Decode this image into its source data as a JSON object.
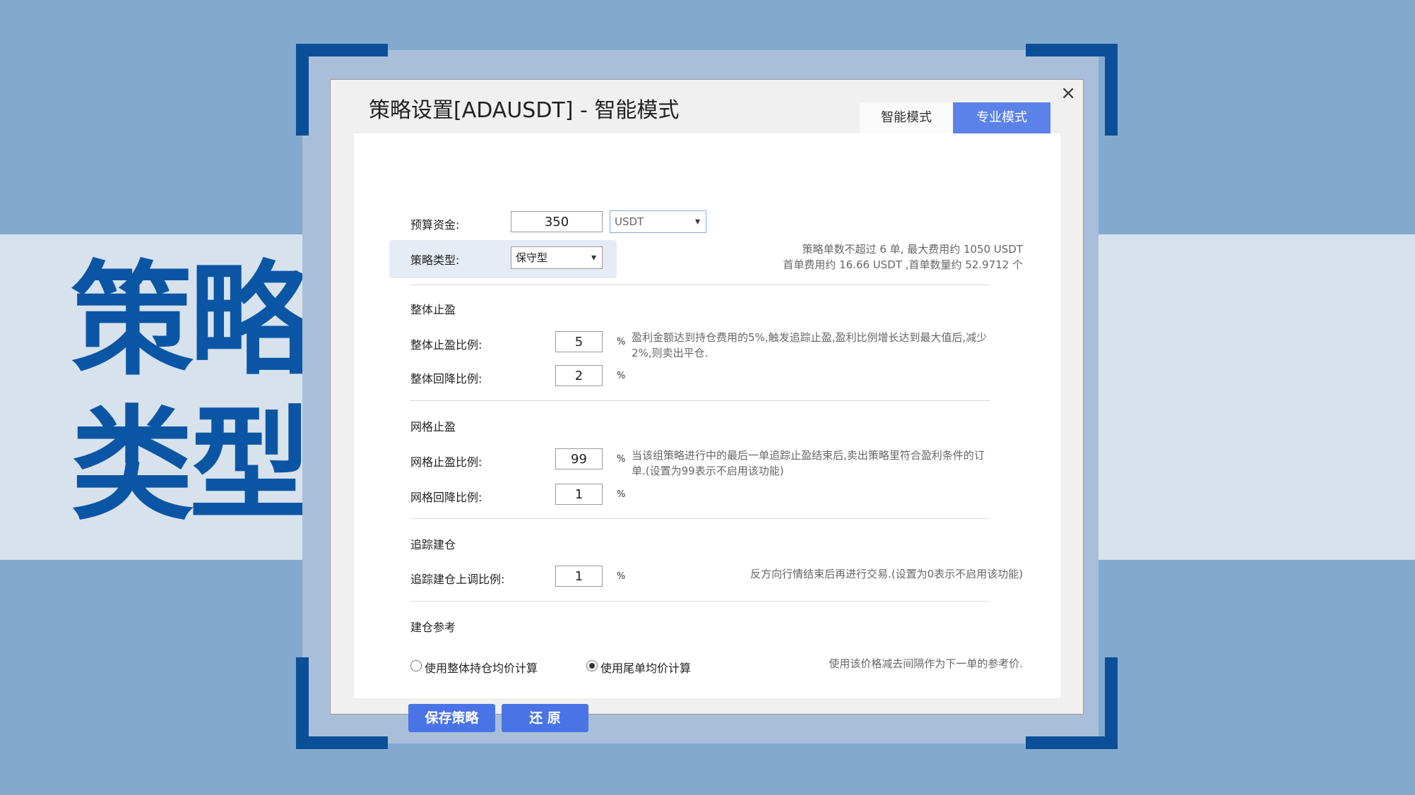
{
  "overlay": {
    "title_line1": "策略",
    "title_line2": "类型"
  },
  "dialog": {
    "title": "策略设置[ADAUSDT] - 智能模式",
    "close_label": "×",
    "tabs": [
      {
        "label": "智能模式",
        "active": false
      },
      {
        "label": "专业模式",
        "active": true
      }
    ]
  },
  "budget": {
    "label": "预算资金:",
    "value": "350",
    "currency": "USDT"
  },
  "strategy_type": {
    "label": "策略类型:",
    "value": "保守型"
  },
  "summary": {
    "line1": "策略单数不超过 6 单, 最大费用约 1050 USDT",
    "line2": "首单费用约 16.66 USDT ,首单数量约 52.9712 个"
  },
  "overall_tp": {
    "section": "整体止盈",
    "ratio_label": "整体止盈比例:",
    "ratio_value": "5",
    "pullback_label": "整体回降比例:",
    "pullback_value": "2",
    "unit": "%",
    "hint_line1": "盈利金额达到持仓费用的5%,触发追踪止盈,盈利比例增长达到最大值后,减少",
    "hint_line2": "2%,则卖出平仓."
  },
  "grid_tp": {
    "section": "网格止盈",
    "ratio_label": "网格止盈比例:",
    "ratio_value": "99",
    "pullback_label": "网格回降比例:",
    "pullback_value": "1",
    "unit": "%",
    "hint_line1": "当该组策略进行中的最后一单追踪止盈结束后,卖出策略里符合盈利条件的订",
    "hint_line2": "单.(设置为99表示不启用该功能)"
  },
  "trail_open": {
    "section": "追踪建仓",
    "ratio_label": "追踪建仓上调比例:",
    "ratio_value": "1",
    "unit": "%",
    "hint": "反方向行情结束后再进行交易.(设置为0表示不启用该功能)"
  },
  "open_ref": {
    "section": "建仓参考",
    "option1": "使用整体持仓均价计算",
    "option2": "使用尾单均价计算",
    "selected": 2,
    "hint": "使用该价格减去间隔作为下一单的参考价."
  },
  "buttons": {
    "save": "保存策略",
    "reset": "还 原"
  },
  "colors": {
    "background": "#84a9cf",
    "band": "#d8e2ed",
    "frame": "#0b4f99",
    "accent": "#4a74e6"
  }
}
